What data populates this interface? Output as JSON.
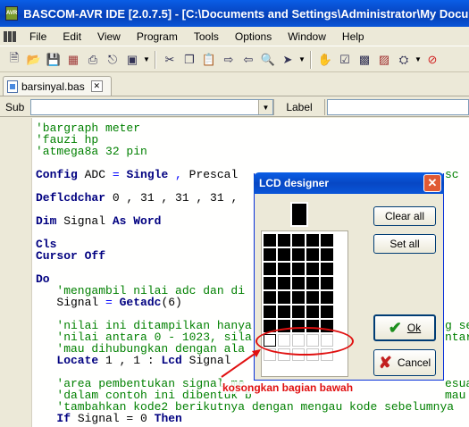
{
  "window": {
    "title": "BASCOM-AVR IDE [2.0.7.5] - [C:\\Documents and Settings\\Administrator\\My Docume",
    "logo_text": "AVR"
  },
  "menu": [
    "File",
    "Edit",
    "View",
    "Program",
    "Tools",
    "Options",
    "Window",
    "Help"
  ],
  "toolbar": {
    "icons": [
      "new-file-icon",
      "open-folder-icon",
      "save-icon",
      "save-all-icon",
      "print-icon",
      "print-preview-icon",
      "close-file-icon",
      "find-icon",
      "cut-icon",
      "copy-icon",
      "paste-icon",
      "indent-icon",
      "unindent-icon",
      "search-icon",
      "find-next-icon",
      "hand-icon",
      "compile-icon",
      "chip-icon",
      "program-chip-icon",
      "chip-settings-icon",
      "stop-icon"
    ]
  },
  "tabs": [
    {
      "label": "barsinyal.bas"
    }
  ],
  "subbar": {
    "sub_label": "Sub",
    "label_button": "Label"
  },
  "code": [
    "'bargraph meter",
    "'fauzi hp",
    "'atmega8a 32 pin",
    "",
    "Config ADC = Single , Prescal",
    "",
    "Deflcdchar 0 , 31 , 31 , 31 ,",
    "",
    "Dim Signal As Word",
    "",
    "Cls",
    "Cursor Off",
    "",
    "Do",
    "   'mengambil nilai adc dan di",
    "   Signal = Getadc(6)",
    "",
    "   'nilai ini ditampilkan hanya",
    "   'nilai antara 0 - 1023, sila",
    "   'mau dihubungkan dengan ala",
    "   Locate 1 , 1 : Lcd Signal",
    "",
    "   'area pembentukan signal me",
    "   'dalam contoh ini dibentuk b",
    "   'tambahkan kode2 berikutnya dengan mengau kode sebelumnya",
    "   If Signal = 0 Then"
  ],
  "code_right_fragments": {
    "line5": "sc",
    "line18": "g se",
    "line19": "ntar",
    "line23": "esuai",
    "line24": "mau"
  },
  "lcd_designer": {
    "title": "LCD designer",
    "clear_all": "Clear all",
    "set_all": "Set all",
    "ok": "Ok",
    "cancel": "Cancel",
    "pixels": [
      [
        1,
        1,
        1,
        1,
        1
      ],
      [
        1,
        1,
        1,
        1,
        1
      ],
      [
        1,
        1,
        1,
        1,
        1
      ],
      [
        1,
        1,
        1,
        1,
        1
      ],
      [
        1,
        1,
        1,
        1,
        1
      ],
      [
        1,
        1,
        1,
        1,
        1
      ],
      [
        1,
        1,
        1,
        1,
        1
      ],
      [
        2,
        0,
        0,
        0,
        0
      ],
      [
        0,
        0,
        0,
        0,
        0
      ]
    ]
  },
  "annotation": {
    "text": "kosongkan bagian bawah",
    "color": "#e01010"
  }
}
